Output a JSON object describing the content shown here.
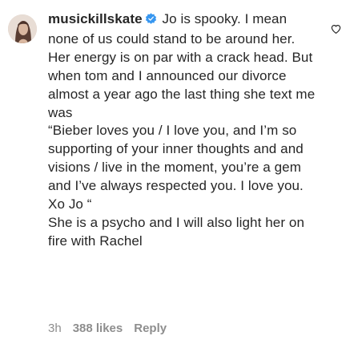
{
  "comment": {
    "username": "musickillskate",
    "verified": true,
    "lines": [
      "Jo is spooky. I mean none of us could stand to be around her. Her energy is on par with a crack head. But when tom and I announced our divorce almost a year ago the last thing she text me was",
      "“Bieber loves you / I love you, and I’m so supporting of your inner thoughts and and visions / live in the moment, you’re a gem and I’ve always respected you. I love you.",
      "Xo Jo “",
      "She is a psycho and I will also light her on fire with Rachel"
    ],
    "time": "3h",
    "likes": "388 likes",
    "reply": "Reply"
  },
  "icons": {
    "avatar": "profile-photo",
    "verified": "verified-badge-icon",
    "like": "heart-outline-icon"
  },
  "colors": {
    "text": "#262626",
    "muted": "#8e8e8e",
    "verified_blue": "#3897f0"
  }
}
